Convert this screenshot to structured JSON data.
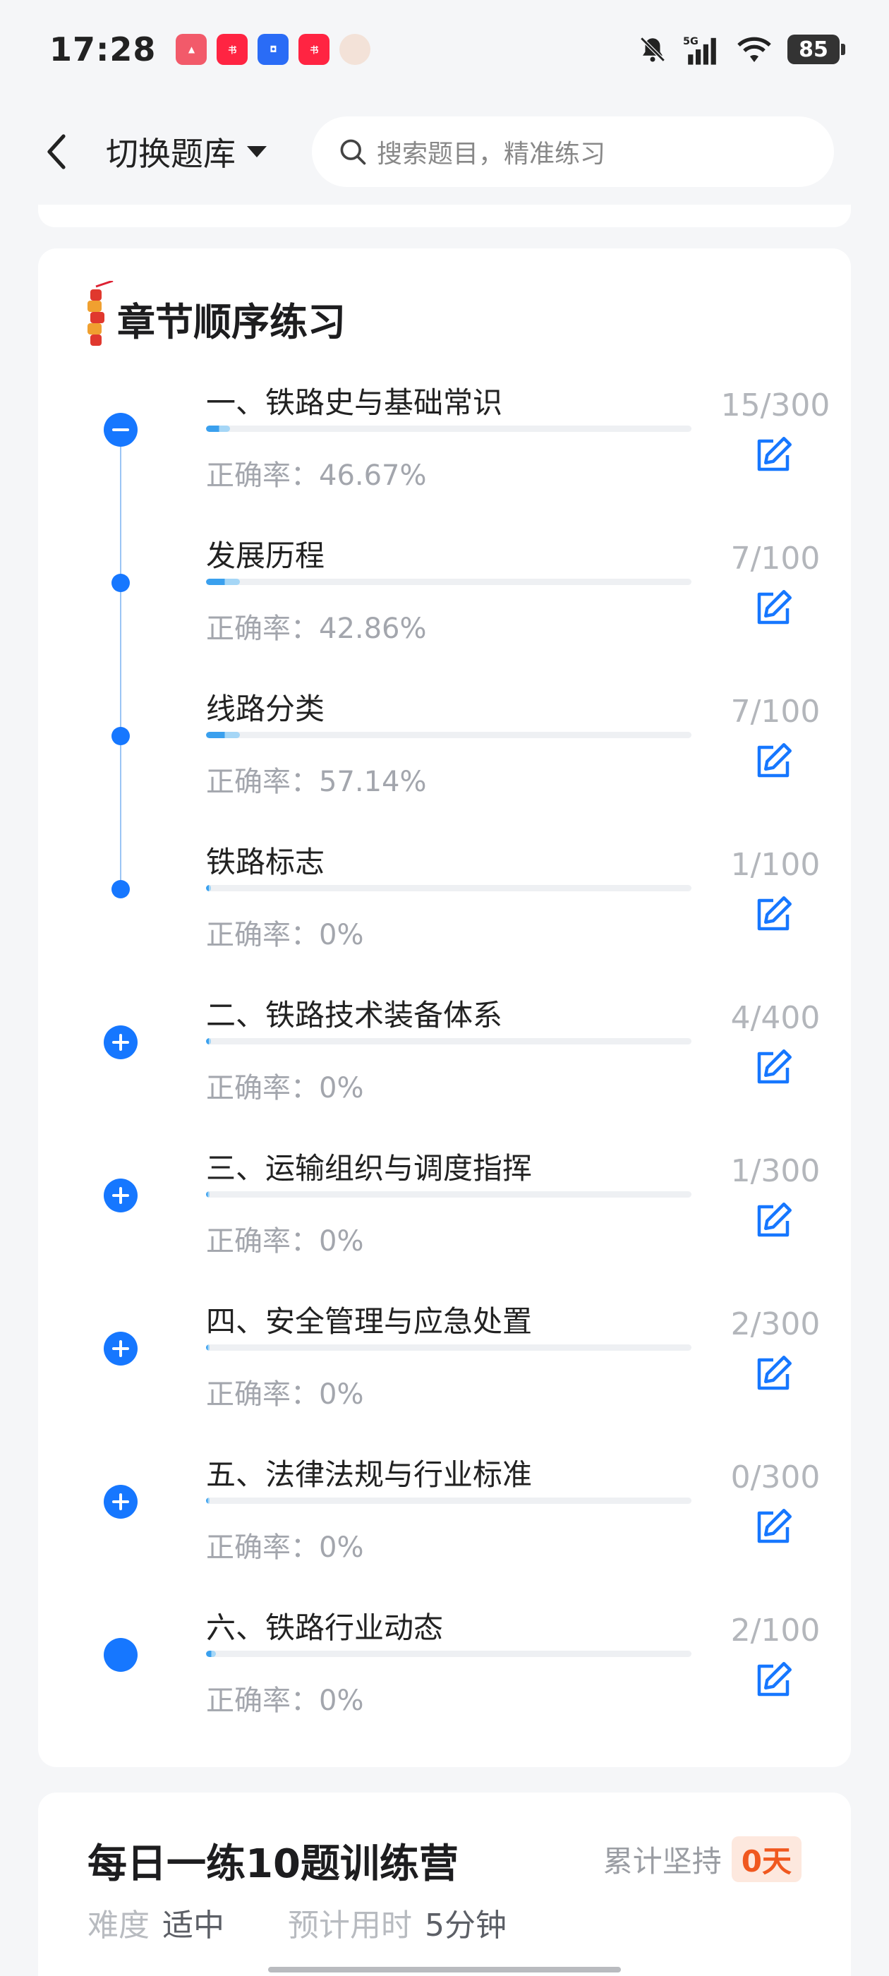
{
  "status_bar": {
    "time": "17:28",
    "app_icons": [
      "app-red-triangle-icon",
      "xiaohongshu-icon",
      "blue-app-icon",
      "xiaohongshu-icon-2",
      "avatar-icon"
    ],
    "right_icons": [
      "mute-bell-icon",
      "signal-5g-icon",
      "wifi-icon"
    ],
    "battery": "85"
  },
  "nav": {
    "switch_label": "切换题库",
    "search_placeholder": "搜索题目，精准练习"
  },
  "chapter_card": {
    "title": "章节顺序练习",
    "chapters": [
      {
        "title": "一、铁路史与基础常识",
        "accuracy": "正确率：46.67%",
        "count": "15/300",
        "progress": 0.05,
        "node": "minus"
      },
      {
        "title": "发展历程",
        "accuracy": "正确率：42.86%",
        "count": "7/100",
        "progress": 0.07,
        "node": "dot"
      },
      {
        "title": "线路分类",
        "accuracy": "正确率：57.14%",
        "count": "7/100",
        "progress": 0.07,
        "node": "dot"
      },
      {
        "title": "铁路标志",
        "accuracy": "正确率：0%",
        "count": "1/100",
        "progress": 0.01,
        "node": "dot"
      },
      {
        "title": "二、铁路技术装备体系",
        "accuracy": "正确率：0%",
        "count": "4/400",
        "progress": 0.01,
        "node": "plus"
      },
      {
        "title": "三、运输组织与调度指挥",
        "accuracy": "正确率：0%",
        "count": "1/300",
        "progress": 0.003,
        "node": "plus"
      },
      {
        "title": "四、安全管理与应急处置",
        "accuracy": "正确率：0%",
        "count": "2/300",
        "progress": 0.007,
        "node": "plus"
      },
      {
        "title": "五、法律法规与行业标准",
        "accuracy": "正确率：0%",
        "count": "0/300",
        "progress": 0.0,
        "node": "plus"
      },
      {
        "title": "六、铁路行业动态",
        "accuracy": "正确率：0%",
        "count": "2/100",
        "progress": 0.02,
        "node": "solid"
      }
    ]
  },
  "daily_card": {
    "title": "每日一练10题训练营",
    "persist_label": "累计坚持",
    "persist_value": "0天",
    "difficulty_label": "难度",
    "difficulty_value": "适中",
    "time_label": "预计用时",
    "time_value": "5分钟"
  },
  "colors": {
    "accent": "#1677ff",
    "progress": "#3aa0ee",
    "badge_text": "#f0581f",
    "badge_bg": "#fde8de"
  }
}
